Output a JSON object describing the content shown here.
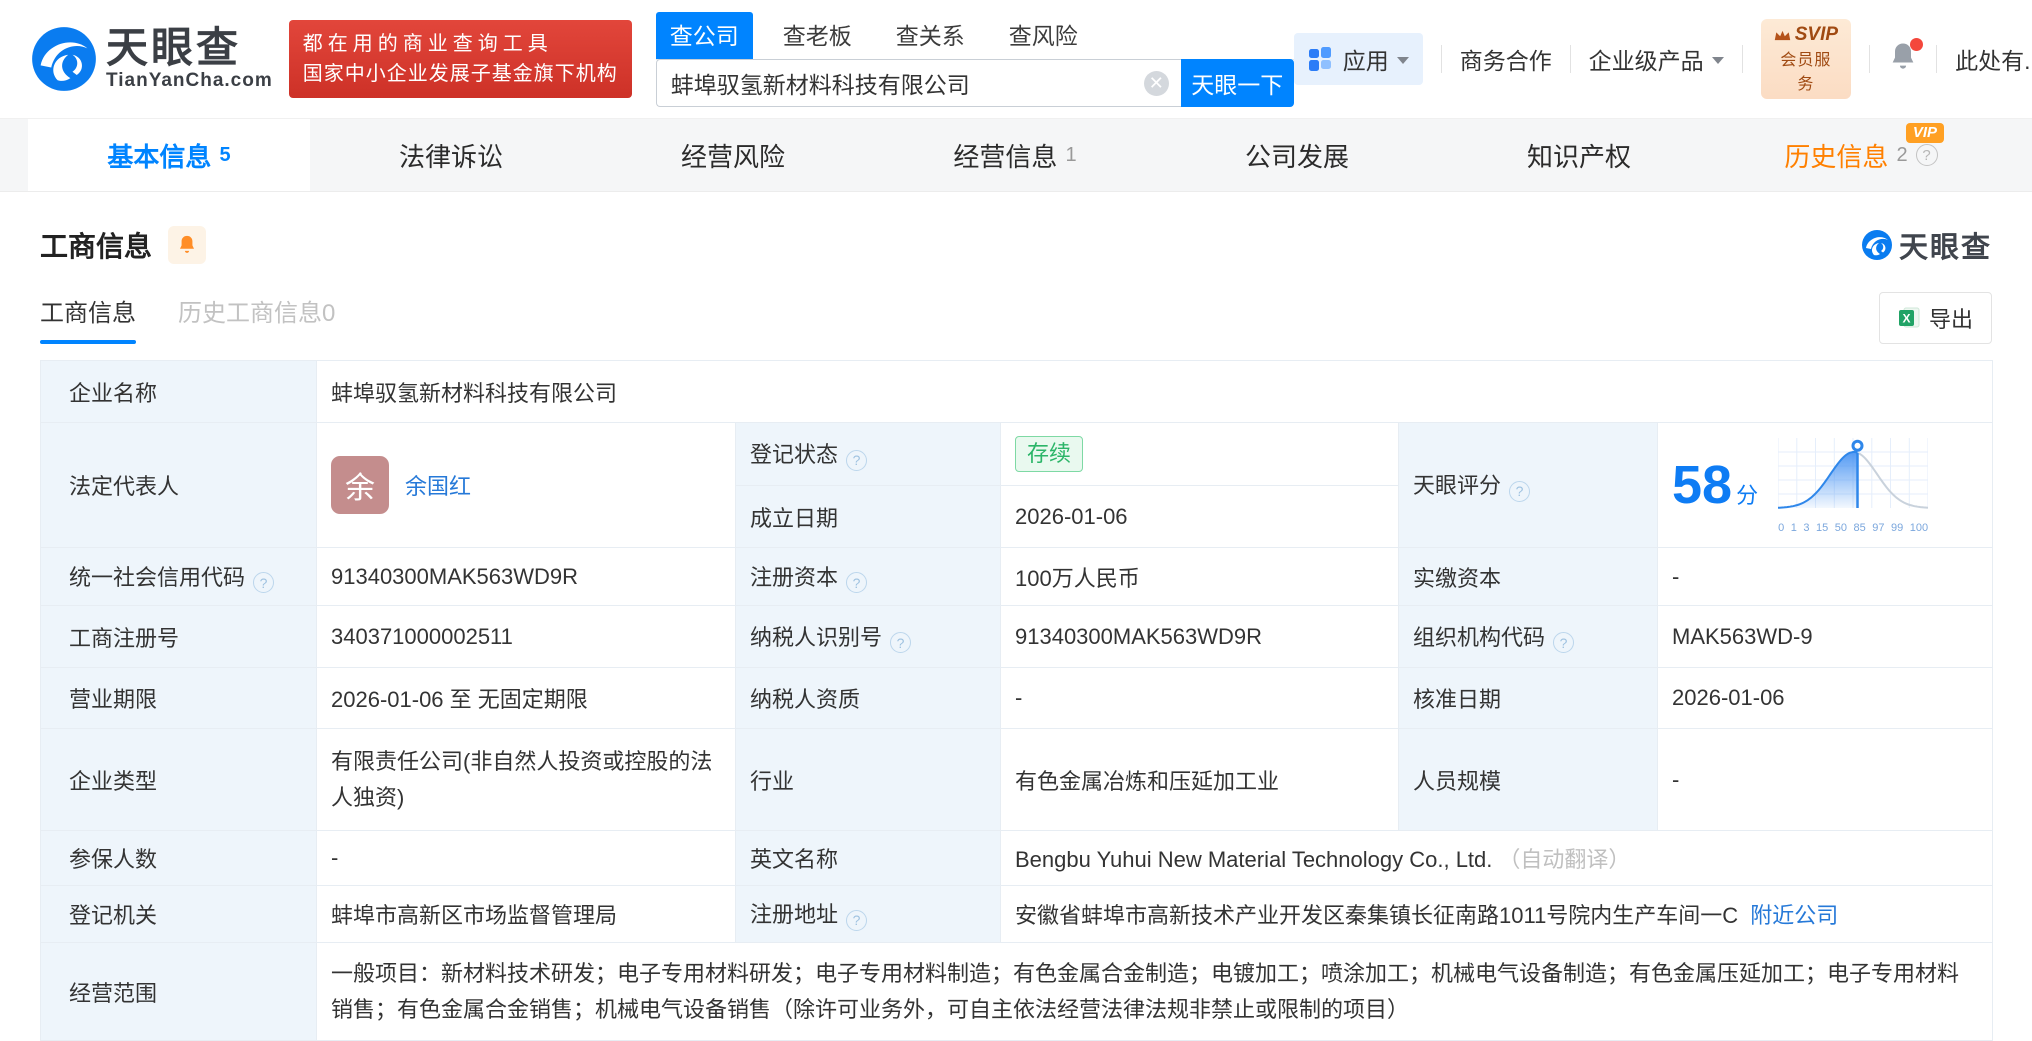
{
  "brand": {
    "logo_text": "天眼查",
    "logo_domain": "TianYanCha.com",
    "promo_line1": "都在用的商业查询工具",
    "promo_line2": "国家中小企业发展子基金旗下机构"
  },
  "search": {
    "tabs": [
      "查公司",
      "查老板",
      "查关系",
      "查风险"
    ],
    "value": "蚌埠驭氢新材料科技有限公司",
    "button_label": "天眼一下"
  },
  "header_nav": {
    "apps_label": "应用",
    "coop_label": "商务合作",
    "enterprise_label": "企业级产品",
    "svip_line1": "SVIP",
    "svip_line2": "会员服务",
    "user_label": "此处有..."
  },
  "main_tabs": [
    {
      "label": "基本信息",
      "count": "5"
    },
    {
      "label": "法律诉讼"
    },
    {
      "label": "经营风险"
    },
    {
      "label": "经营信息",
      "count": "1"
    },
    {
      "label": "公司发展"
    },
    {
      "label": "知识产权"
    },
    {
      "label": "历史信息",
      "count": "2",
      "vip_badge": "VIP"
    }
  ],
  "section": {
    "title": "工商信息",
    "watermark": "天眼查",
    "subtab_current": "工商信息",
    "subtab_history": "历史工商信息0",
    "export_label": "导出"
  },
  "table": {
    "company_name": {
      "label": "企业名称",
      "value": "蚌埠驭氢新材料科技有限公司"
    },
    "legal_rep": {
      "label": "法定代表人",
      "avatar": "余",
      "name": "余国红"
    },
    "reg_status": {
      "label": "登记状态",
      "value": "存续"
    },
    "establish_date": {
      "label": "成立日期",
      "value": "2026-01-06"
    },
    "tyc_score": {
      "label": "天眼评分"
    },
    "credit_code": {
      "label": "统一社会信用代码",
      "value": "91340300MAK563WD9R"
    },
    "reg_capital": {
      "label": "注册资本",
      "value": "100万人民币"
    },
    "paid_capital": {
      "label": "实缴资本",
      "value": "-"
    },
    "reg_number": {
      "label": "工商注册号",
      "value": "340371000002511"
    },
    "taxpayer_id": {
      "label": "纳税人识别号",
      "value": "91340300MAK563WD9R"
    },
    "org_code": {
      "label": "组织机构代码",
      "value": "MAK563WD-9"
    },
    "business_term": {
      "label": "营业期限",
      "value": "2026-01-06 至 无固定期限"
    },
    "taxpayer_quality": {
      "label": "纳税人资质",
      "value": "-"
    },
    "approval_date": {
      "label": "核准日期",
      "value": "2026-01-06"
    },
    "company_type": {
      "label": "企业类型",
      "value": "有限责任公司(非自然人投资或控股的法人独资)"
    },
    "industry": {
      "label": "行业",
      "value": "有色金属冶炼和压延加工业"
    },
    "staff_size": {
      "label": "人员规模",
      "value": "-"
    },
    "insured_count": {
      "label": "参保人数",
      "value": "-"
    },
    "english_name": {
      "label": "英文名称",
      "value": "Bengbu Yuhui New Material Technology Co., Ltd.",
      "note": "（自动翻译）"
    },
    "reg_authority": {
      "label": "登记机关",
      "value": "蚌埠市高新区市场监督管理局"
    },
    "reg_address": {
      "label": "注册地址",
      "value": "安徽省蚌埠市高新技术产业开发区秦集镇长征南路1011号院内生产车间一C",
      "link": "附近公司"
    },
    "business_scope": {
      "label": "经营范围",
      "value": "一般项目：新材料技术研发；电子专用材料研发；电子专用材料制造；有色金属合金制造；电镀加工；喷涂加工；机械电气设备制造；有色金属压延加工；电子专用材料销售；有色金属合金销售；机械电气设备销售（除许可业务外，可自主依法经营法律法规非禁止或限制的项目）"
    }
  },
  "chart_data": {
    "type": "area",
    "title": "天眼评分",
    "score": "58",
    "score_unit": "分",
    "x_tick_labels": [
      "0",
      "1",
      "3",
      "15",
      "50",
      "85",
      "97",
      "99",
      "100"
    ],
    "marker_position": 0.53,
    "mu": 0.505,
    "sigma": 0.155,
    "grid": true,
    "fill_color": "#3f8ef2",
    "line_color": "#2f87ea",
    "rest_line_color": "#c9d2dc",
    "grid_color": "#e5eefb",
    "accent_color": "#0e7cf4"
  }
}
